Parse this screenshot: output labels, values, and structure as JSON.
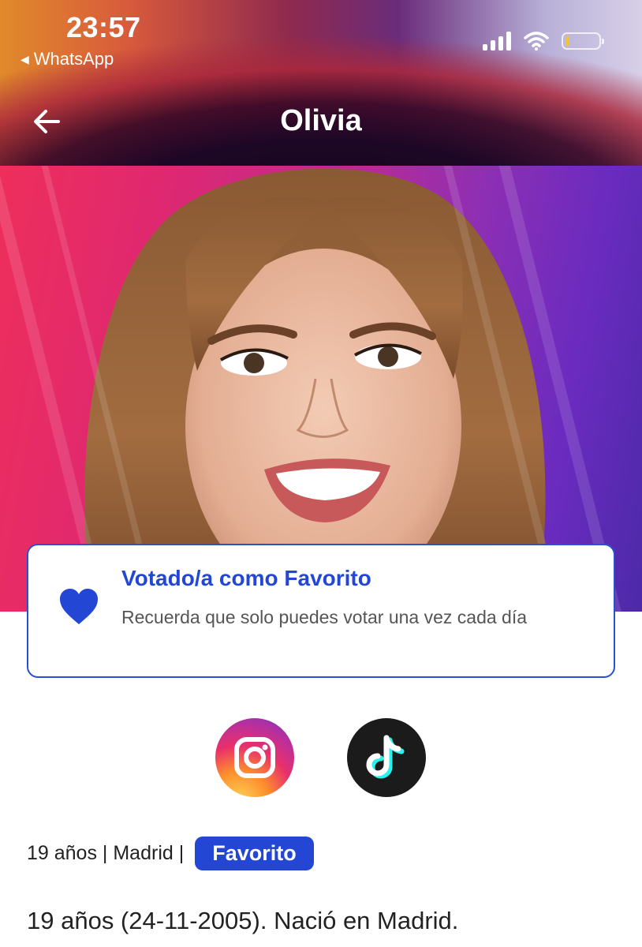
{
  "status_bar": {
    "time": "23:57",
    "back_app": "WhatsApp",
    "battery_color": "#f4c430"
  },
  "header": {
    "title": "Olivia",
    "back_icon": "arrow-left-icon"
  },
  "favorite_card": {
    "title": "Votado/a como Favorito",
    "text": "Recuerda que solo puedes votar una vez cada día",
    "icon": "heart-icon",
    "accent": "#2347d4"
  },
  "socials": [
    {
      "name": "instagram",
      "icon": "instagram-icon"
    },
    {
      "name": "tiktok",
      "icon": "tiktok-icon"
    }
  ],
  "profile": {
    "age": "19 años",
    "city": "Madrid",
    "status_badge": "Favorito",
    "bio": "19 años (24-11-2005).  Nació en Madrid."
  }
}
